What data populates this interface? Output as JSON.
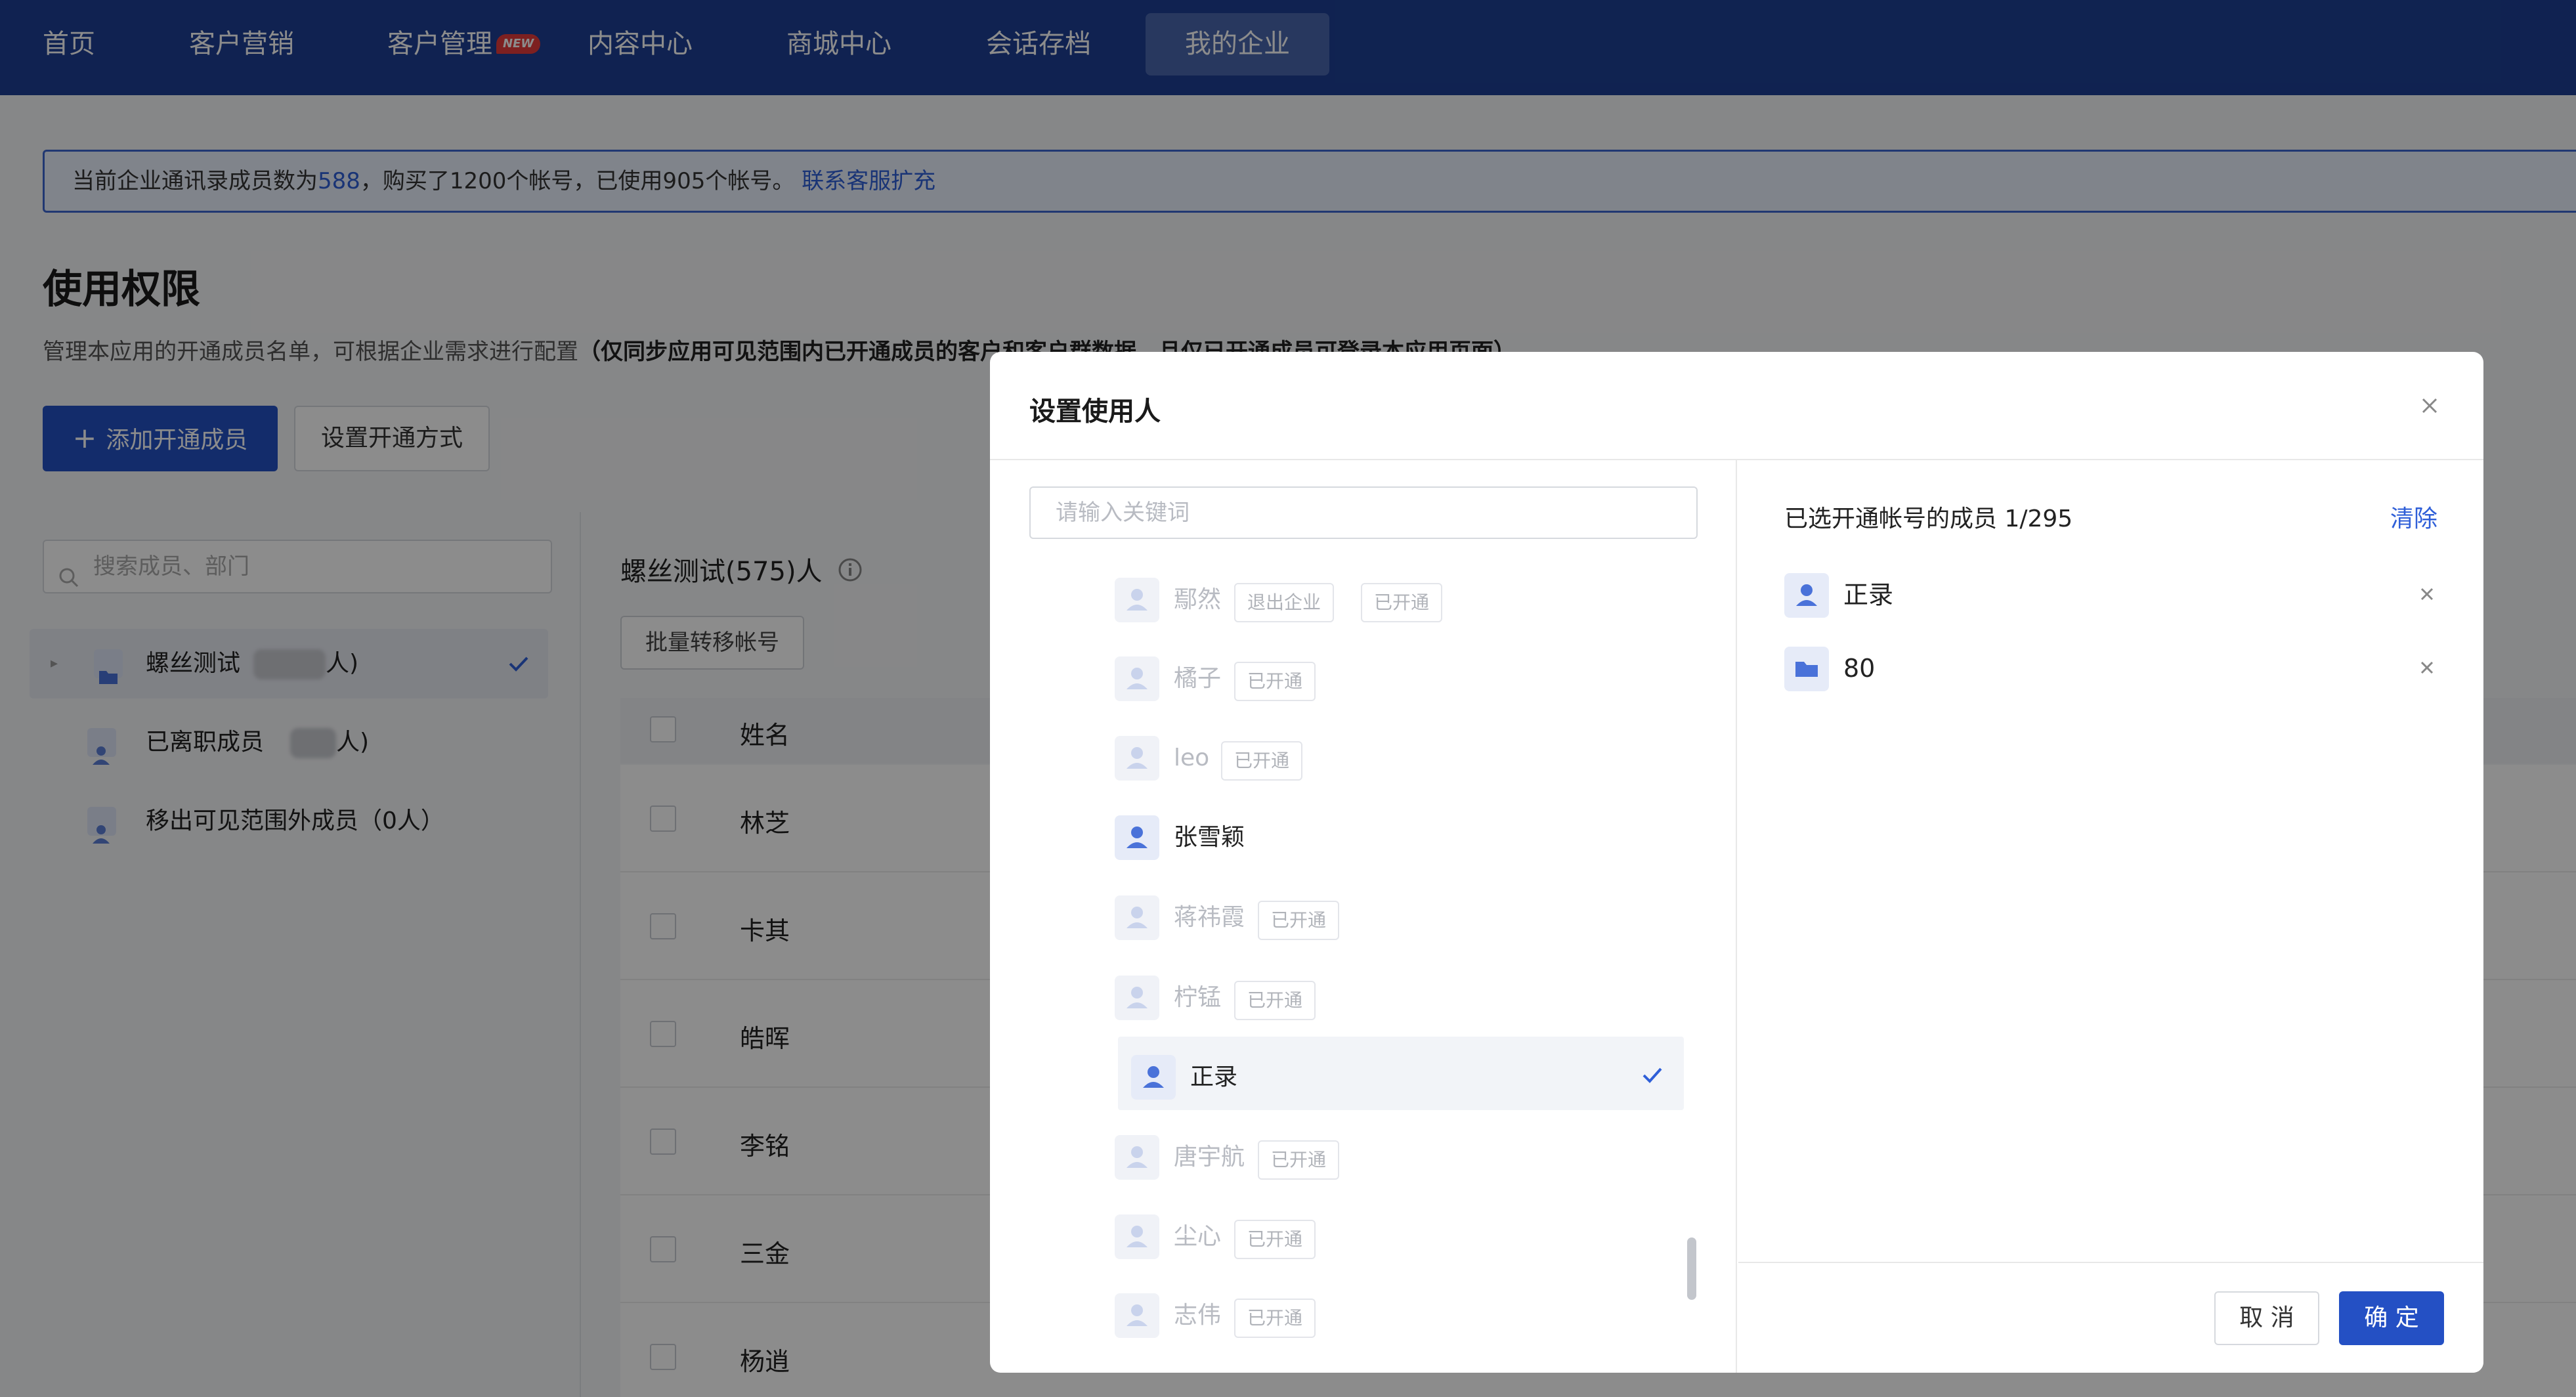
{
  "nav": {
    "items": [
      {
        "label": "首页"
      },
      {
        "label": "客户营销"
      },
      {
        "label": "客户管理",
        "badge": "NEW"
      },
      {
        "label": "内容中心"
      },
      {
        "label": "商城中心"
      },
      {
        "label": "会话存档"
      },
      {
        "label": "我的企业",
        "active": true
      }
    ]
  },
  "banner": {
    "prefix": "当前企业通讯录成员数为",
    "member_count": "588",
    "middle": "，购买了1200个帐号，已使用905个帐号。",
    "link": "联系客服扩充"
  },
  "page": {
    "title": "使用权限",
    "desc": "管理本应用的开通成员名单，可根据企业需求进行配置",
    "desc_bold": "（仅同步应用可见范围内已开通成员的客户和客户群数据，且仅已开通成员可登录本应用页面）",
    "add_button": "添加开通成员",
    "setup_button": "设置开通方式"
  },
  "sidebar": {
    "search_placeholder": "搜索成员、部门",
    "items": [
      {
        "label_pre": "螺丝测试",
        "label_post": "人)"
      },
      {
        "label_pre": "已离职成员",
        "label_post": "人)"
      },
      {
        "label": "移出可见范围外成员（0人）"
      }
    ]
  },
  "main": {
    "title": "螺丝测试(575)人",
    "batch_button": "批量转移帐号",
    "column_name": "姓名",
    "rows": [
      "林芝",
      "卡其",
      "皓晖",
      "李铭",
      "三金",
      "杨逍"
    ]
  },
  "modal": {
    "title": "设置使用人",
    "search_placeholder": "请输入关键词",
    "members": [
      {
        "name": "鄢然",
        "tags": [
          "退出企业",
          "已开通"
        ]
      },
      {
        "name": "橘子",
        "tags": [
          "已开通"
        ]
      },
      {
        "name": "leo",
        "tags": [
          "已开通"
        ]
      },
      {
        "name": "张雪颖",
        "tags": []
      },
      {
        "name": "蒋祎霞",
        "tags": [
          "已开通"
        ]
      },
      {
        "name": "柠锰",
        "tags": [
          "已开通"
        ]
      },
      {
        "name": "正录",
        "tags": [],
        "selected": true
      },
      {
        "name": "唐宇航",
        "tags": [
          "已开通"
        ]
      },
      {
        "name": "尘心",
        "tags": [
          "已开通"
        ]
      },
      {
        "name": "志伟",
        "tags": [
          "已开通"
        ]
      }
    ],
    "selected_label": "已选开通帐号的成员 1/295",
    "clear": "清除",
    "selected": [
      {
        "name": "正录",
        "type": "person-icon"
      },
      {
        "name": "80",
        "type": "folder-icon"
      }
    ],
    "cancel": "取 消",
    "confirm": "确 定"
  },
  "colors": {
    "nav_bg": "#1e3f94",
    "primary": "#2450c4",
    "link": "#2f5fd8"
  }
}
